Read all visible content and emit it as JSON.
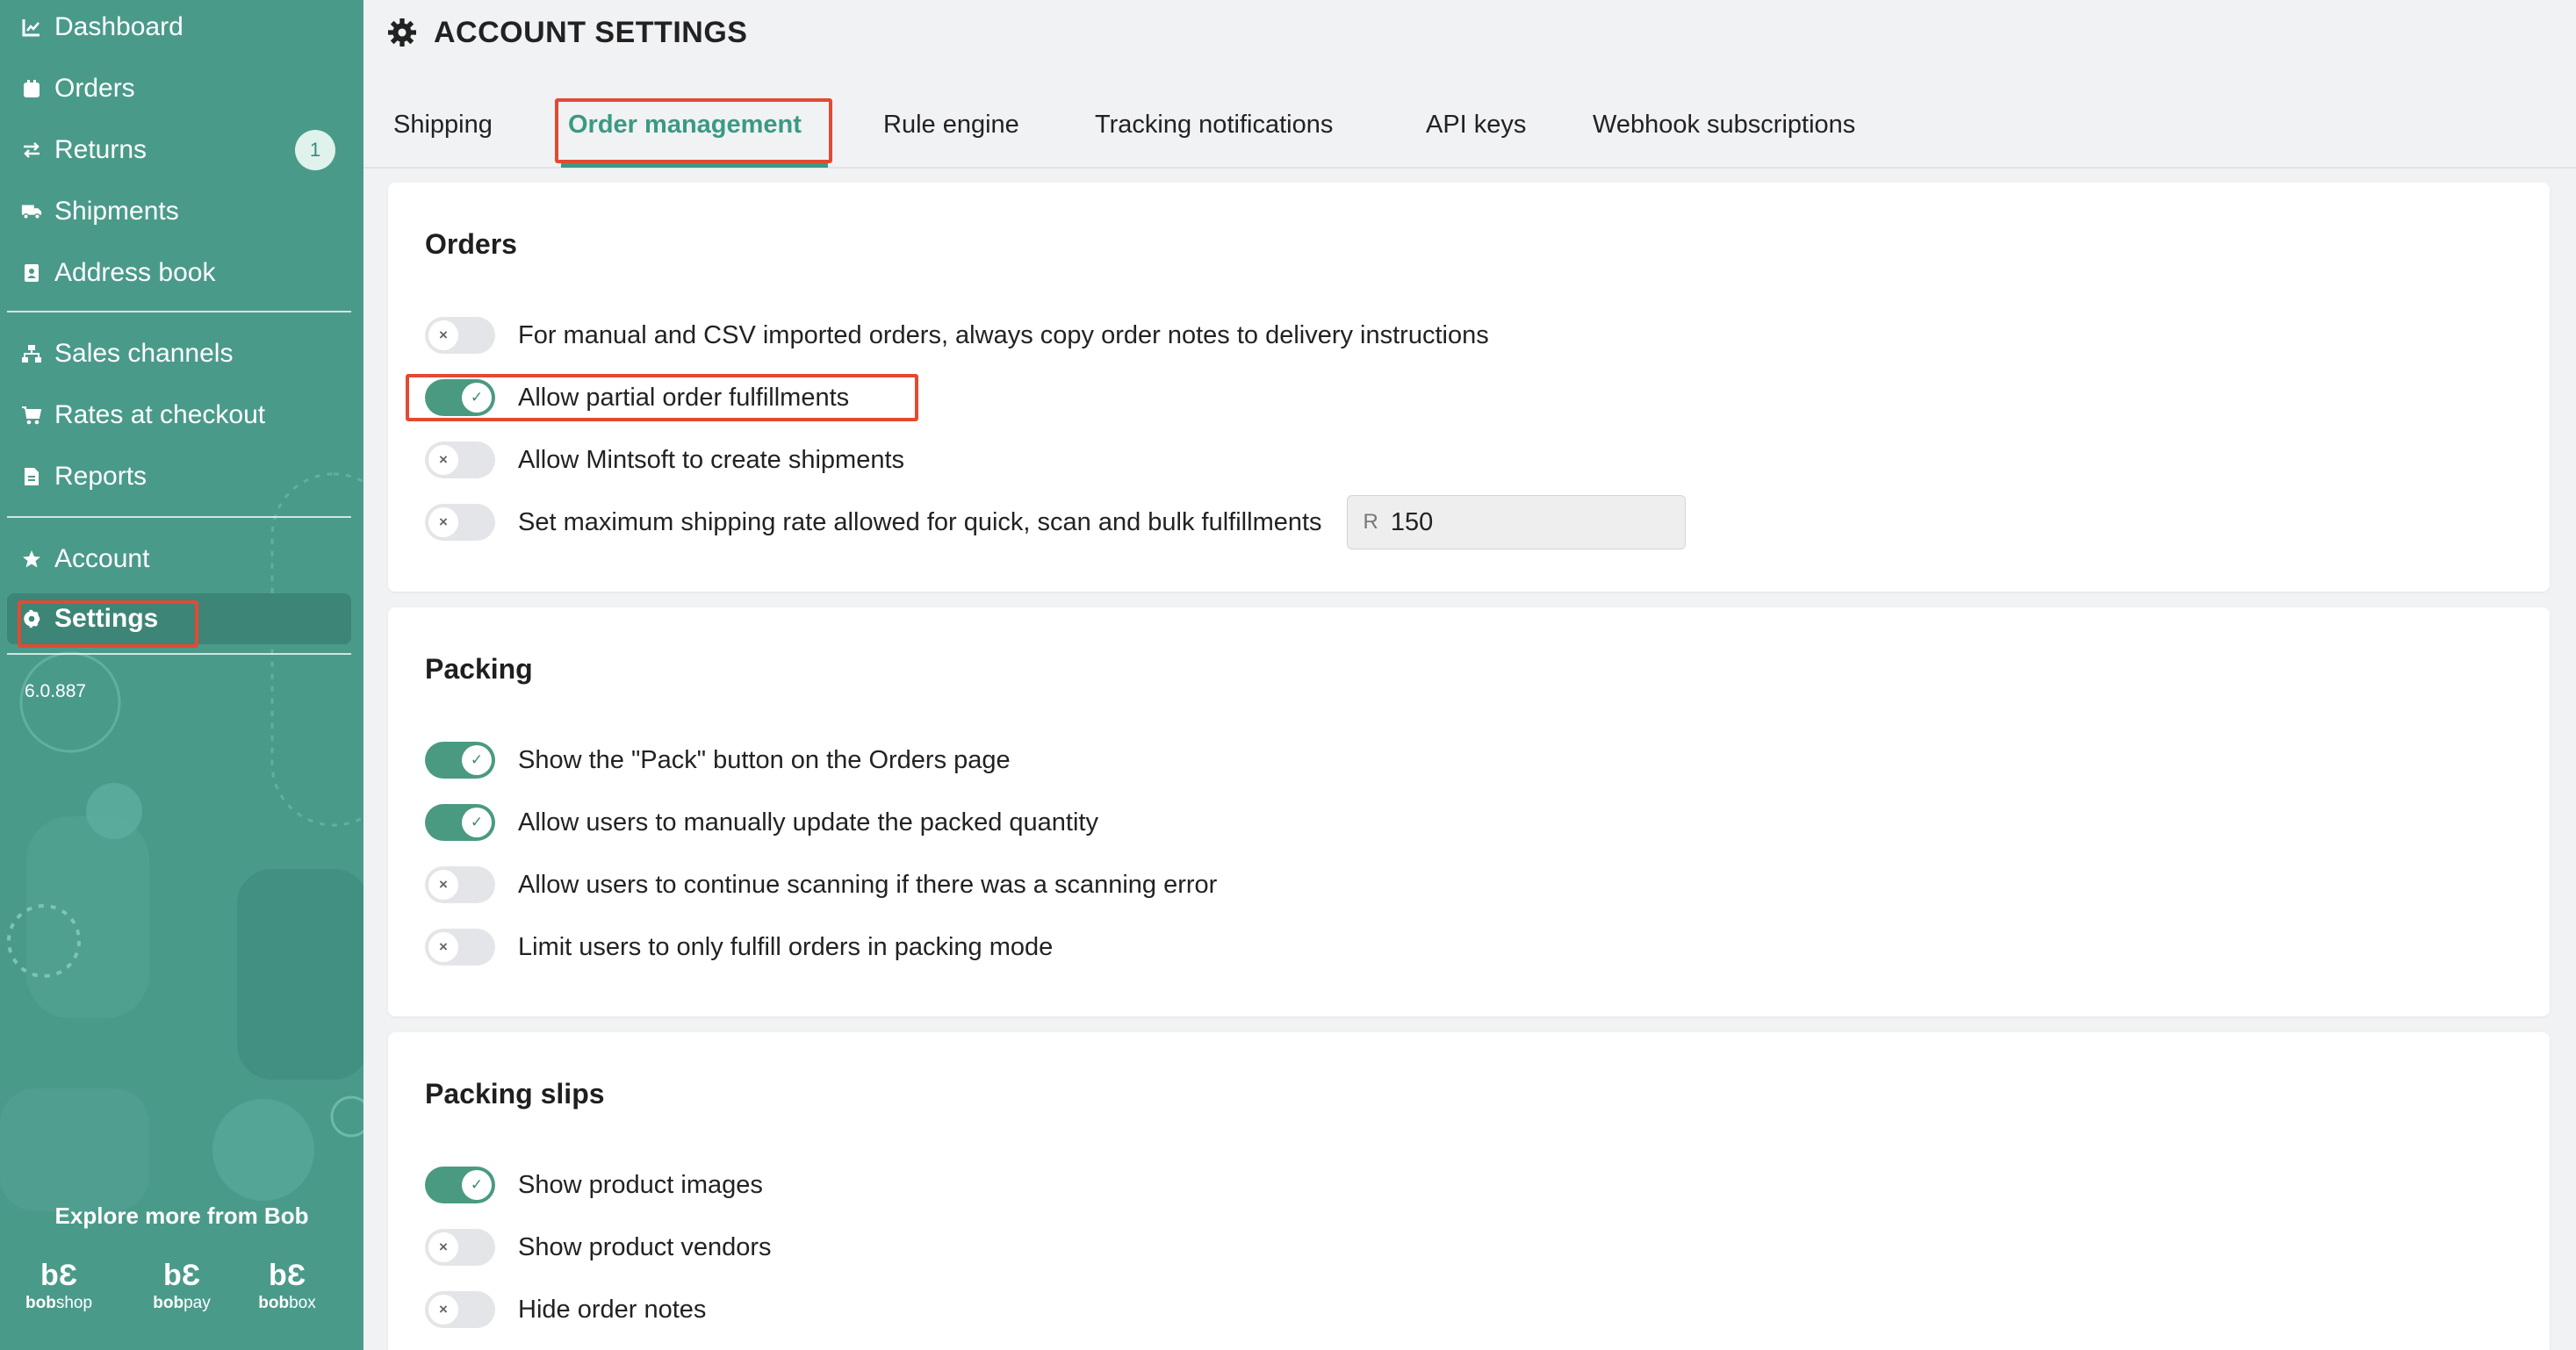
{
  "sidebar": {
    "items": [
      {
        "label": "Dashboard",
        "icon": "chart-line-icon"
      },
      {
        "label": "Orders",
        "icon": "calendar-icon"
      },
      {
        "label": "Returns",
        "icon": "exchange-icon",
        "badge": "1"
      },
      {
        "label": "Shipments",
        "icon": "truck-icon"
      },
      {
        "label": "Address book",
        "icon": "address-book-icon"
      },
      {
        "label": "Sales channels",
        "icon": "sitemap-icon"
      },
      {
        "label": "Rates at checkout",
        "icon": "shopping-cart-icon"
      },
      {
        "label": "Reports",
        "icon": "file-icon"
      },
      {
        "label": "Account",
        "icon": "star-icon"
      },
      {
        "label": "Settings",
        "icon": "gear-icon",
        "active": true
      }
    ],
    "version": "6.0.887",
    "explore_title": "Explore more from Bob",
    "brands": [
      {
        "prefix": "bob",
        "suffix": "shop"
      },
      {
        "prefix": "bob",
        "suffix": "pay"
      },
      {
        "prefix": "bob",
        "suffix": "box"
      }
    ]
  },
  "header": {
    "title": "ACCOUNT SETTINGS",
    "icon": "gear-icon"
  },
  "tabs": [
    {
      "label": "Shipping"
    },
    {
      "label": "Order management",
      "active": true
    },
    {
      "label": "Rule engine"
    },
    {
      "label": "Tracking notifications"
    },
    {
      "label": "API keys"
    },
    {
      "label": "Webhook subscriptions"
    }
  ],
  "sections": {
    "orders": {
      "title": "Orders",
      "items": [
        {
          "label": "For manual and CSV imported orders, always copy order notes to delivery instructions",
          "enabled": false
        },
        {
          "label": "Allow partial order fulfillments",
          "enabled": true
        },
        {
          "label": "Allow Mintsoft to create shipments",
          "enabled": false
        },
        {
          "label": "Set maximum shipping rate allowed for quick, scan and bulk fulfillments",
          "enabled": false
        }
      ],
      "max_rate": {
        "currency": "R",
        "value": "150"
      }
    },
    "packing": {
      "title": "Packing",
      "items": [
        {
          "label": "Show the \"Pack\" button on the Orders page",
          "enabled": true
        },
        {
          "label": "Allow users to manually update the packed quantity",
          "enabled": true
        },
        {
          "label": "Allow users to continue scanning if there was a scanning error",
          "enabled": false
        },
        {
          "label": "Limit users to only fulfill orders in packing mode",
          "enabled": false
        }
      ]
    },
    "packing_slips": {
      "title": "Packing slips",
      "items": [
        {
          "label": "Show product images",
          "enabled": true
        },
        {
          "label": "Show product vendors",
          "enabled": false
        },
        {
          "label": "Hide order notes",
          "enabled": false
        }
      ]
    }
  },
  "toggle_glyphs": {
    "on": "✓",
    "off": "×"
  },
  "colors": {
    "sidebar": "#4a9a8a",
    "accent": "#3a9a82",
    "highlight": "#e24a33"
  }
}
